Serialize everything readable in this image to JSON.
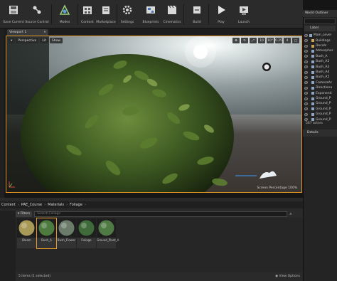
{
  "toolbar": {
    "buttons": [
      {
        "label": "Save Current",
        "icon": "save-icon"
      },
      {
        "label": "Source Control",
        "icon": "source-control-icon"
      },
      {
        "label": "Modes",
        "icon": "modes-icon"
      },
      {
        "label": "Content",
        "icon": "content-icon"
      },
      {
        "label": "Marketplace",
        "icon": "marketplace-icon"
      },
      {
        "label": "Settings",
        "icon": "settings-icon"
      },
      {
        "label": "Blueprints",
        "icon": "blueprints-icon"
      },
      {
        "label": "Cinematics",
        "icon": "cinematics-icon"
      },
      {
        "label": "Build",
        "icon": "build-icon"
      },
      {
        "label": "Play",
        "icon": "play-icon"
      },
      {
        "label": "Launch",
        "icon": "launch-icon"
      }
    ]
  },
  "viewport": {
    "tab_label": "Viewport 1",
    "tab_close": "×",
    "view_mode": "Perspective",
    "lit_mode": "Lit",
    "show_label": "Show",
    "right_values": [
      "10",
      "10°",
      "0.25",
      "4"
    ],
    "screen_percentage_label": "Screen Percentage",
    "screen_percentage_value": "100%"
  },
  "outliner": {
    "tab_label": "World Outliner",
    "header_label": "Label",
    "rows": [
      {
        "label": "Main_Level",
        "indent": 1
      },
      {
        "label": "Buildings",
        "indent": 2
      },
      {
        "label": "Decals",
        "indent": 2
      },
      {
        "label": "Atmospher",
        "indent": 2
      },
      {
        "label": "Bush_A",
        "indent": 2
      },
      {
        "label": "Bush_A2",
        "indent": 2
      },
      {
        "label": "Bush_A3",
        "indent": 2
      },
      {
        "label": "Bush_A4",
        "indent": 2
      },
      {
        "label": "Bush_A5",
        "indent": 2
      },
      {
        "label": "CameraAc",
        "indent": 2
      },
      {
        "label": "Directiona",
        "indent": 2
      },
      {
        "label": "Exponenti",
        "indent": 2
      },
      {
        "label": "Ground_P",
        "indent": 2
      },
      {
        "label": "Ground_P",
        "indent": 2
      },
      {
        "label": "Ground_P",
        "indent": 2
      },
      {
        "label": "Ground_P",
        "indent": 2
      },
      {
        "label": "Ground_P",
        "indent": 2
      }
    ],
    "actors_count": "567 actors",
    "details_tab": "Details"
  },
  "content_browser": {
    "breadcrumbs": [
      "Content",
      "PAE_Course",
      "Materials",
      "Foliage"
    ],
    "filters_label": "Filters",
    "search_placeholder": "Search Foliage",
    "assets": [
      {
        "label": "Bloom",
        "color": "#a89a56"
      },
      {
        "label": "Bush_A",
        "color": "#4d7a3e"
      },
      {
        "label": "Bush_Flower",
        "color": "#6b7c6b"
      },
      {
        "label": "Foliage",
        "color": "#3f6a3a"
      },
      {
        "label": "Ground_Plant_A",
        "color": "#507a44"
      }
    ],
    "footer_count": "5 items (1 selected)",
    "view_options": "View Options"
  },
  "colors": {
    "accent": "#e59a28",
    "panel_bg": "#242424"
  }
}
